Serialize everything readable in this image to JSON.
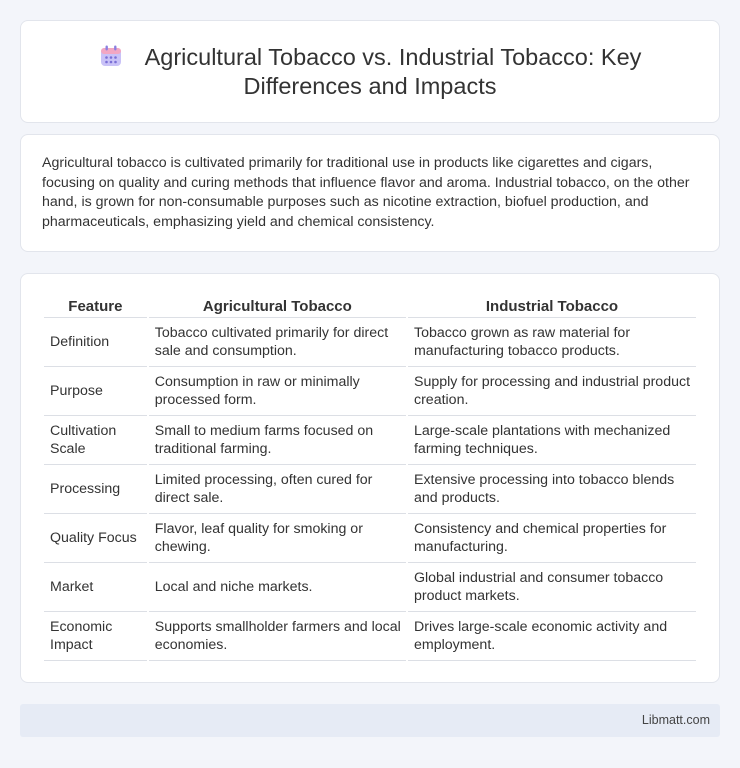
{
  "header": {
    "title": "Agricultural Tobacco vs. Industrial Tobacco: Key Differences and Impacts",
    "icon": "calendar-icon"
  },
  "intro": {
    "text": "Agricultural tobacco is cultivated primarily for traditional use in products like cigarettes and cigars, focusing on quality and curing methods that influence flavor and aroma. Industrial tobacco, on the other hand, is grown for non-consumable purposes such as nicotine extraction, biofuel production, and pharmaceuticals, emphasizing yield and chemical consistency."
  },
  "table": {
    "headers": [
      "Feature",
      "Agricultural Tobacco",
      "Industrial Tobacco"
    ],
    "rows": [
      [
        "Definition",
        "Tobacco cultivated primarily for direct sale and consumption.",
        "Tobacco grown as raw material for manufacturing tobacco products."
      ],
      [
        "Purpose",
        "Consumption in raw or minimally processed form.",
        "Supply for processing and industrial product creation."
      ],
      [
        "Cultivation Scale",
        "Small to medium farms focused on traditional farming.",
        "Large-scale plantations with mechanized farming techniques."
      ],
      [
        "Processing",
        "Limited processing, often cured for direct sale.",
        "Extensive processing into tobacco blends and products."
      ],
      [
        "Quality Focus",
        "Flavor, leaf quality for smoking or chewing.",
        "Consistency and chemical properties for manufacturing."
      ],
      [
        "Market",
        "Local and niche markets.",
        "Global industrial and consumer tobacco product markets."
      ],
      [
        "Economic Impact",
        "Supports smallholder farmers and local economies.",
        "Drives large-scale economic activity and employment."
      ]
    ]
  },
  "footer": {
    "brand": "Libmatt.com"
  },
  "colors": {
    "page_background": "#f3f5fa",
    "card_background": "#ffffff",
    "footer_background": "#e6ebf5",
    "icon_purple": "#8b7fe0",
    "icon_pink": "#f2a7c3"
  }
}
